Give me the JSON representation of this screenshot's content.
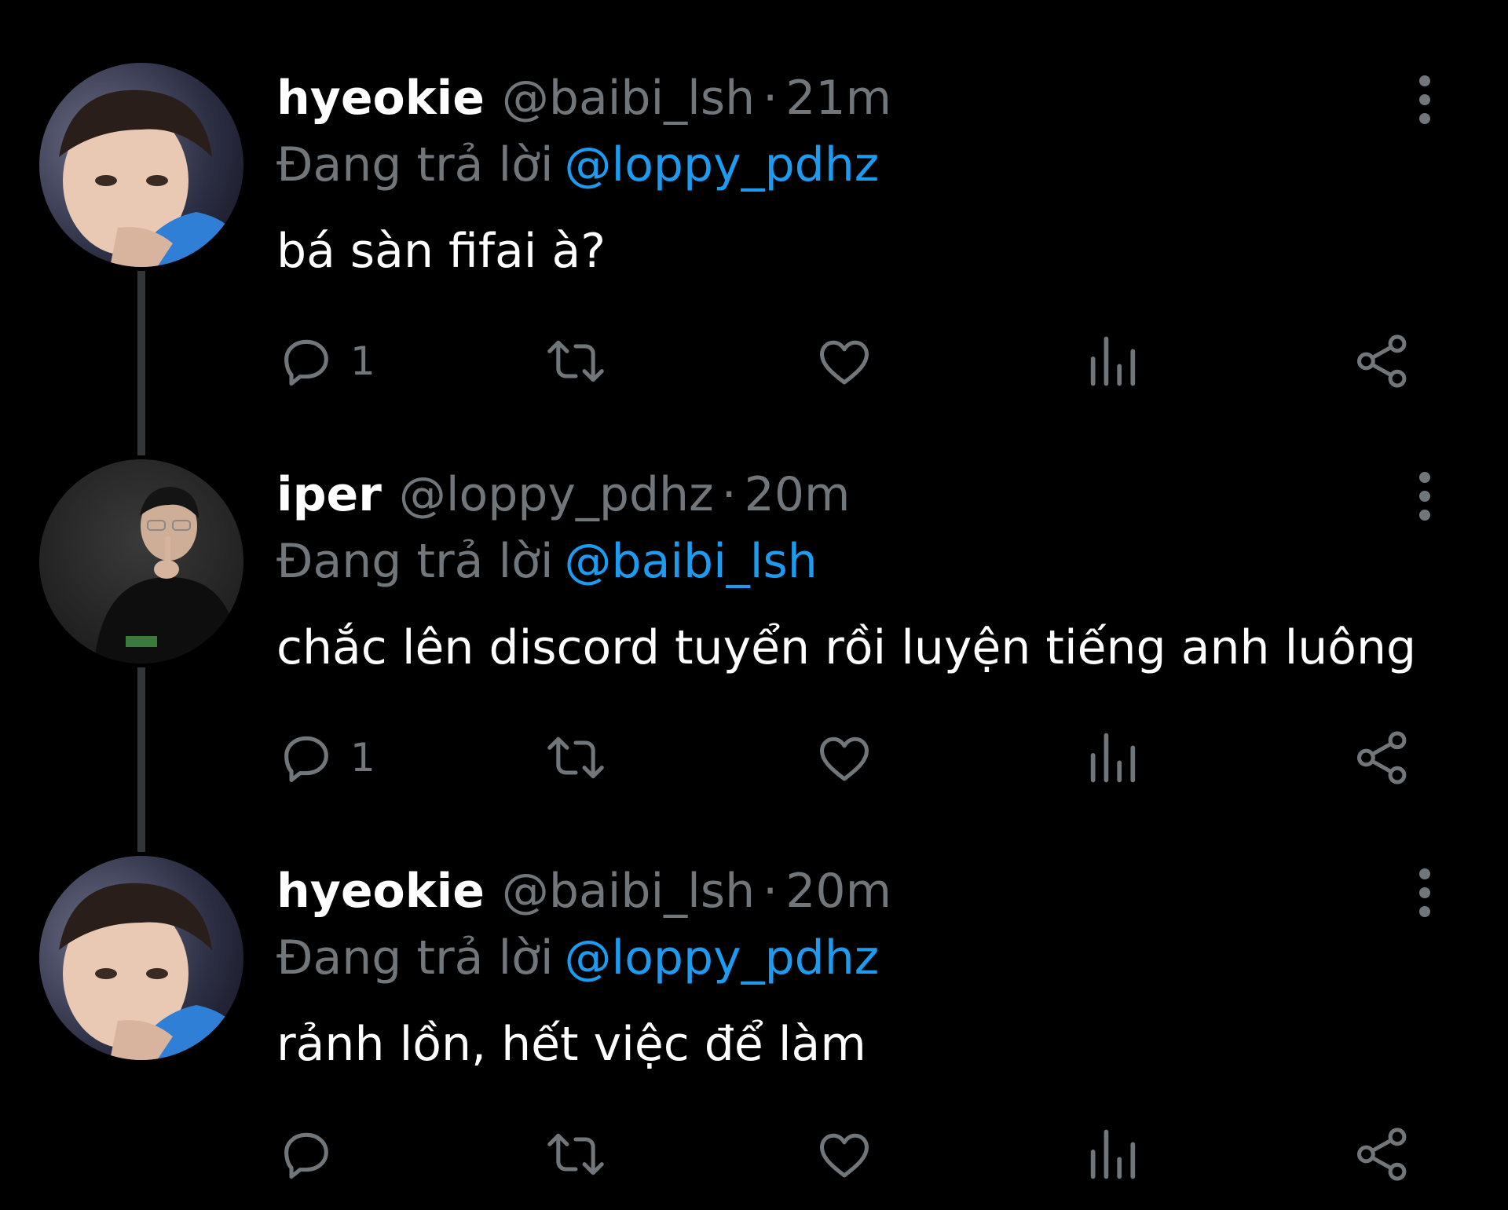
{
  "theme": {
    "background": "#000000",
    "name_color": "#ffffff",
    "muted_color": "#71767b",
    "mention_color": "#1d9bf0",
    "text_color": "#ffffff"
  },
  "tweets": [
    {
      "display_name": "hyeokie",
      "handle": "@baibi_lsh",
      "separator": "·",
      "time": "21m",
      "reply_prefix": "Đang trả lời",
      "reply_mention": "@loppy_pdhz",
      "text": "bá sàn fifai à?",
      "reply_count": "1",
      "avatar_icon": "user-photo-avatar"
    },
    {
      "display_name": "iper",
      "handle": "@loppy_pdhz",
      "separator": "·",
      "time": "20m",
      "reply_prefix": "Đang trả lời",
      "reply_mention": "@baibi_lsh",
      "text": "chắc lên discord tuyển rồi luyện tiếng anh luông",
      "reply_count": "1",
      "avatar_icon": "user-photo-avatar"
    },
    {
      "display_name": "hyeokie",
      "handle": "@baibi_lsh",
      "separator": "·",
      "time": "20m",
      "reply_prefix": "Đang trả lời",
      "reply_mention": "@loppy_pdhz",
      "text": "rảnh lồn, hết việc để làm",
      "reply_count": "",
      "avatar_icon": "user-photo-avatar"
    }
  ],
  "action_icons": [
    "reply-icon",
    "retweet-icon",
    "like-icon",
    "views-icon",
    "share-icon"
  ]
}
